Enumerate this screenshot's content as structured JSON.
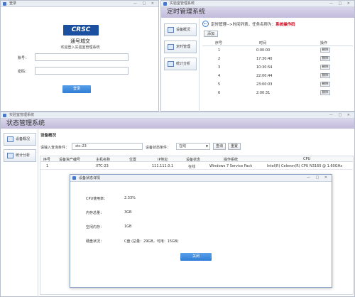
{
  "login": {
    "title": "登录",
    "logo_text": "CRSC",
    "company": "通号城交",
    "welcome": "欢迎登入实验室管理系统",
    "account_label": "账号：",
    "password_label": "密码：",
    "login_button": "登录"
  },
  "timer": {
    "window_title": "实验室管理系统",
    "header": "定时管理系统",
    "nav": {
      "device_overview": "设备概况",
      "timer_manage": "定时管理",
      "stats": "统计分析"
    },
    "breadcrumb_prefix": "定时管理-->时间列表，任务名称为：",
    "task_name": "系统操作码",
    "add_button": "添加",
    "columns": [
      "序号",
      "时间",
      "操作"
    ],
    "rows": [
      {
        "seq": "1",
        "time": "0:00:00",
        "op": "删除"
      },
      {
        "seq": "2",
        "time": "17:30:40",
        "op": "删除"
      },
      {
        "seq": "3",
        "time": "10:30:54",
        "op": "删除"
      },
      {
        "seq": "4",
        "time": "22:00:44",
        "op": "删除"
      },
      {
        "seq": "5",
        "time": "23:00:03",
        "op": "删除"
      },
      {
        "seq": "6",
        "time": "2:00:31",
        "op": "删除"
      }
    ]
  },
  "status": {
    "window_title": "实验室管理系统",
    "header": "状态管理系统",
    "nav": {
      "device_overview": "设备概况",
      "stats": "统计分析"
    },
    "section_title": "设备概况",
    "query_label": "请输入查询条件：",
    "query_value": "xtc-23",
    "state_label": "设备状态条件：",
    "state_value": "在线",
    "query_button": "查询",
    "reset_button": "重置",
    "columns": [
      "序号",
      "设备资产编号",
      "主机名称",
      "位置",
      "IP地址",
      "设备状态",
      "操作系统",
      "CPU"
    ],
    "row": {
      "seq": "1",
      "asset": "",
      "host": "XTC-23",
      "location": "",
      "ip": "111.111.0.1",
      "state": "在线",
      "os": "Windows 7 Service Pack",
      "cpu": "Intel(R) Celeron(R) CPU  N3160  @ 1.60GHz"
    }
  },
  "dialog": {
    "title": "设备状态详情",
    "cpu_label": "CPU使用率：",
    "cpu_value": "2.33%",
    "mem_label": "内存总量：",
    "mem_value": "3GB",
    "free_mem_label": "空闲内存：",
    "free_mem_value": "1GB",
    "disk_label": "硬盘状况：",
    "disk_value": "C盘 (总量：29GB，可用：15GB)",
    "close_button": "关闭"
  },
  "colors": {
    "accent_blue": "#2f7dd6",
    "header_purple": "#c7c0df",
    "task_red": "#d0021b"
  }
}
